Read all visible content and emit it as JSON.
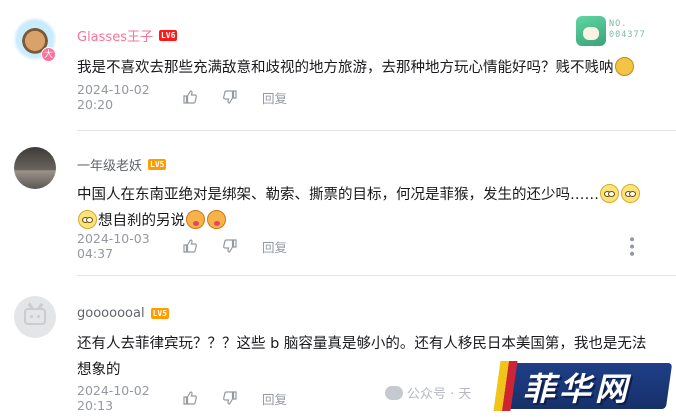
{
  "comments": [
    {
      "username": "Glasses王子",
      "level": "LV6",
      "avatar_badge": "大",
      "fan_badge_no": "NO.\n004377",
      "text": "我是不喜欢去那些充满敌意和歧视的地方旅游，去那种地方玩心情能好吗？贱不贱呐",
      "emoji": "doge-emoji",
      "time": "2024-10-02 20:20",
      "reply_label": "回复"
    },
    {
      "username": "一年级老妖",
      "level": "LV5",
      "text_line1": "中国人在东南亚绝对是绑架、勒索、撕票的目标，何况是菲猴，发生的还少吗……",
      "text_line2": "想自刹的另说",
      "time": "2024-10-03 04:37",
      "reply_label": "回复"
    },
    {
      "username": "gooooooal",
      "level": "LV5",
      "text": "还有人去菲律宾玩？？？这些 b 脑容量真是够小的。还有人移民日本美国第，我也是无法想象的",
      "time": "2024-10-02 20:13",
      "reply_label": "回复"
    }
  ],
  "watermark": "公众号 · 天",
  "site_logo": "菲华网",
  "colors": {
    "vip_name": "#fb7299",
    "meta": "#9499a0",
    "lv6": "#ff1a1a",
    "lv5": "#ff9c00"
  }
}
